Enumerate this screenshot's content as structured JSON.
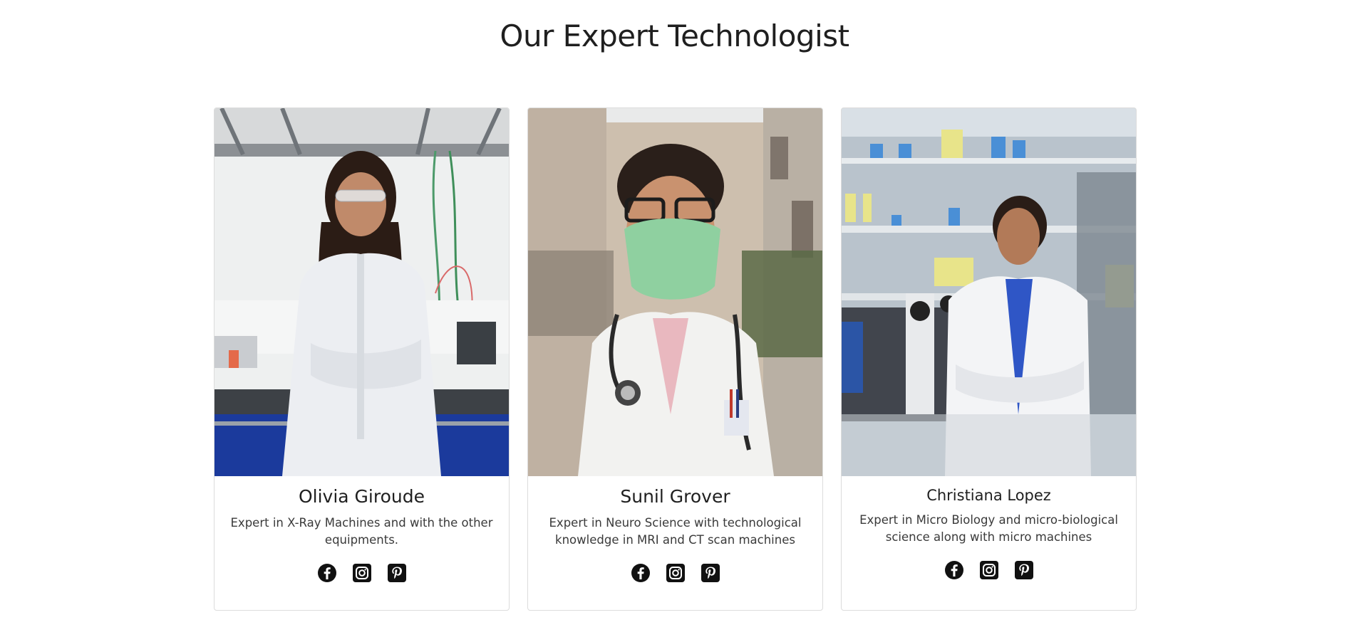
{
  "section": {
    "title": "Our Expert Technologist"
  },
  "colors": {
    "text": "#1f1f1f",
    "border": "#dcdcdc",
    "icon": "#111111"
  },
  "team": [
    {
      "name": "Olivia Giroude",
      "description": "Expert in X-Ray Machines and with the other equipments.",
      "photo_alt": "Olivia Giroude photo",
      "socials": [
        "facebook-icon",
        "instagram-icon",
        "pinterest-icon"
      ]
    },
    {
      "name": "Sunil Grover",
      "description": "Expert in Neuro Science with technological knowledge in MRI and CT scan machines",
      "photo_alt": "Sunil Grover photo",
      "socials": [
        "facebook-icon",
        "instagram-icon",
        "pinterest-icon"
      ]
    },
    {
      "name": "Christiana Lopez",
      "description": "Expert in Micro Biology and micro-biological science along with micro machines",
      "photo_alt": "Christiana Lopez photo",
      "socials": [
        "facebook-icon",
        "instagram-icon",
        "pinterest-icon"
      ]
    }
  ]
}
